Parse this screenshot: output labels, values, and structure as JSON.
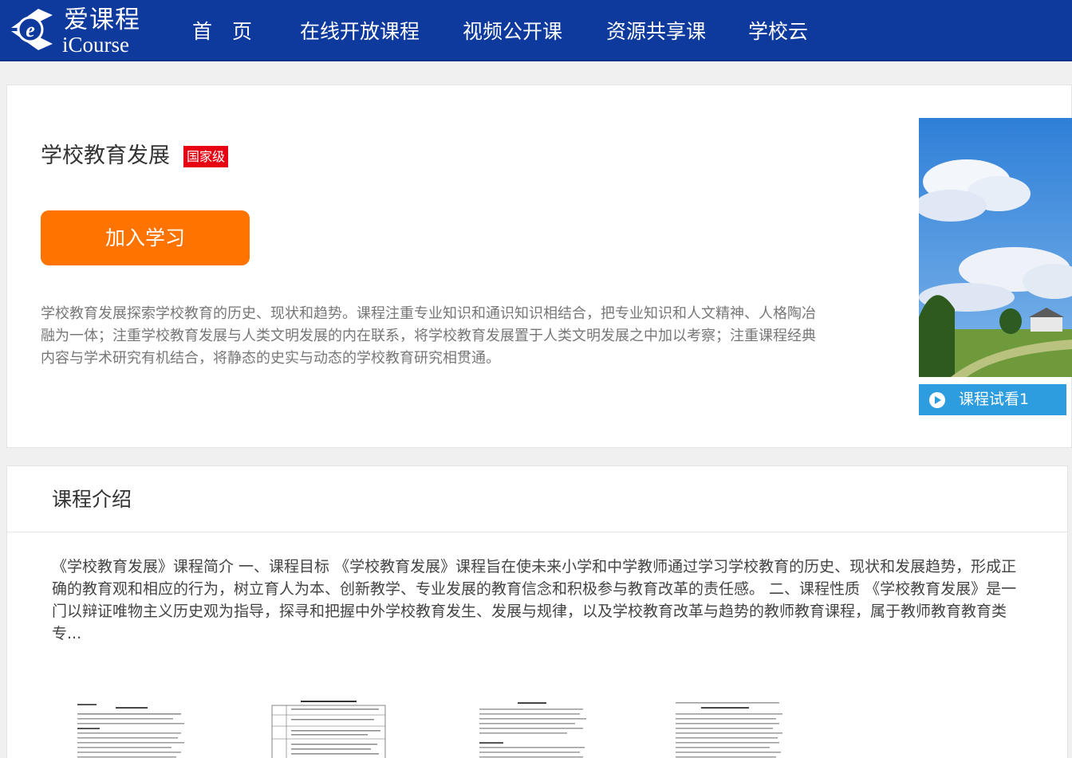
{
  "header": {
    "logo": {
      "cn": "爱课程",
      "en": "iCourse"
    },
    "nav": [
      {
        "label": "首　页"
      },
      {
        "label": "在线开放课程"
      },
      {
        "label": "视频公开课"
      },
      {
        "label": "资源共享课"
      },
      {
        "label": "学校云"
      }
    ]
  },
  "course": {
    "title": "学校教育发展",
    "level_badge": "国家级",
    "join_label": "加入学习",
    "description": "学校教育发展探索学校教育的历史、现状和趋势。课程注重专业知识和通识知识相结合，把专业知识和人文精神、人格陶冶融为一体；注重学校教育发展与人类文明发展的内在联系，将学校教育发展置于人类文明发展之中加以考察；注重课程经典内容与学术研究有机结合，将静态的史实与动态的学校教育研究相贯通。",
    "trial_label": "课程试看1"
  },
  "intro": {
    "heading": "课程介绍",
    "text": "《学校教育发展》课程简介 一、课程目标 《学校教育发展》课程旨在使未来小学和中学教师通过学习学校教育的历史、现状和发展趋势，形成正确的教育观和相应的行为，树立育人为本、创新教学、专业发展的教育信念和积极参与教育改革的责任感。 二、课程性质 《学校教育发展》是一门以辩证唯物主义历史观为指导，探寻和把握中外学校教育发生、发展与规律，以及学校教育改革与趋势的教师教育课程，属于教师教育教育类专..."
  },
  "colors": {
    "header_bg": "#0d3a9c",
    "join_button": "#ff7300",
    "badge": "#e60012",
    "trial_button": "#2d9de0"
  }
}
